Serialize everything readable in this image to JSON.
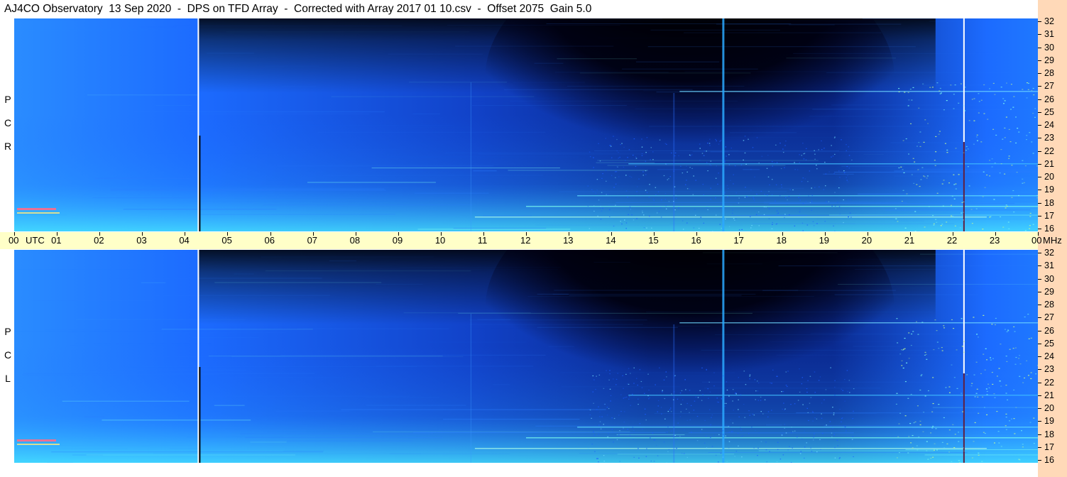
{
  "title": "AJ4CO Observatory  13 Sep 2020  -  DPS on TFD Array  -  Corrected with Array 2017 01 10.csv  -  Offset 2075  Gain 5.0",
  "panels": [
    {
      "id": "rcp",
      "label_letters": [
        "P",
        "C",
        "R"
      ]
    },
    {
      "id": "lcp",
      "label_letters": [
        "P",
        "C",
        "L"
      ]
    }
  ],
  "time_axis": {
    "unit_label": "UTC",
    "freq_unit": "MHz",
    "hour_labels": [
      "00",
      "01",
      "02",
      "03",
      "04",
      "05",
      "06",
      "07",
      "08",
      "09",
      "10",
      "11",
      "12",
      "13",
      "14",
      "15",
      "16",
      "17",
      "18",
      "19",
      "20",
      "21",
      "22",
      "23",
      "00"
    ]
  },
  "freq_axis": {
    "labels": [
      "32",
      "31",
      "30",
      "29",
      "28",
      "27",
      "26",
      "25",
      "24",
      "23",
      "22",
      "21",
      "20",
      "19",
      "18",
      "17",
      "16"
    ]
  },
  "colors": {
    "background": "#ffffff",
    "time_strip": "#ffffc8",
    "freq_strip": "#ffd9b8",
    "low_power": "#000000",
    "mid_power": "#1a5cff",
    "high_power": "#40ffe0"
  },
  "chart_data": {
    "type": "heatmap",
    "title": "AJ4CO Observatory  13 Sep 2020  -  DPS on TFD Array  -  Corrected with Array 2017 01 10.csv  -  Offset 2075  Gain 5.0",
    "xlabel": "UTC",
    "ylabel": "MHz",
    "x_range_hours": [
      0,
      24
    ],
    "y_range_mhz": [
      16,
      32
    ],
    "subplots": [
      "RCP",
      "LCP"
    ],
    "x_ticks": [
      "00",
      "01",
      "02",
      "03",
      "04",
      "05",
      "06",
      "07",
      "08",
      "09",
      "10",
      "11",
      "12",
      "13",
      "14",
      "15",
      "16",
      "17",
      "18",
      "19",
      "20",
      "21",
      "22",
      "23",
      "00"
    ],
    "y_ticks": [
      32,
      31,
      30,
      29,
      28,
      27,
      26,
      25,
      24,
      23,
      22,
      21,
      20,
      19,
      18,
      17,
      16
    ],
    "grid": false
  }
}
